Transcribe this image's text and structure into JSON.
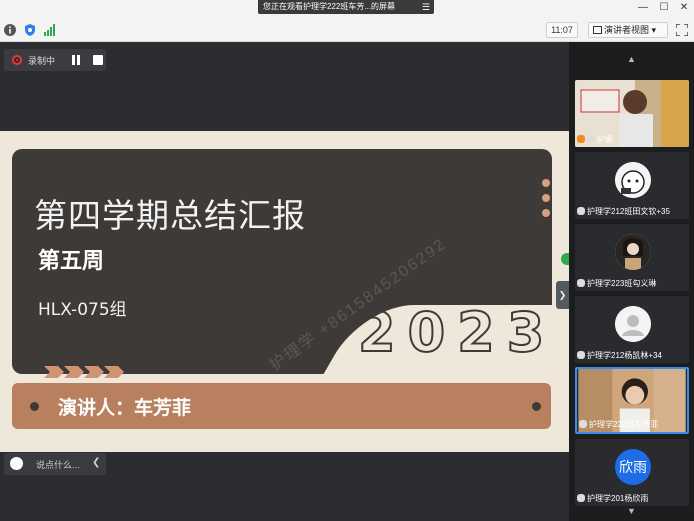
{
  "topbar": {
    "share_banner": "您正在观看护理学222班车芳...的屏幕",
    "clock": "11:07",
    "view_mode": "演讲者视图 ▾",
    "icons": [
      "info-icon",
      "shield-icon",
      "signal-icon"
    ]
  },
  "recording": {
    "label": "录制中"
  },
  "slide": {
    "title": "第四学期总结汇报",
    "week": "第五周",
    "group": "HLX-075组",
    "year": "2023",
    "speaker": "演讲人：车芳菲",
    "watermark": "护理学 +8615845206292"
  },
  "chat": {
    "placeholder": "说点什么..."
  },
  "participants": [
    {
      "name": "护娜",
      "type": "camera"
    },
    {
      "name": "护理学212班田文钦+35",
      "type": "avatar"
    },
    {
      "name": "护理学223班勾义琳",
      "type": "avatar"
    },
    {
      "name": "护理学212杨凯林+34",
      "type": "default-avatar"
    },
    {
      "name": "护理学222班车芳菲",
      "type": "camera",
      "active": true
    },
    {
      "name": "护理学201杨欣雨",
      "type": "text-avatar",
      "avatar_text": "欣雨"
    }
  ],
  "colors": {
    "accent": "#3a8df0",
    "slide_bg": "#efe7da",
    "card": "#3d3a38",
    "brown": "#b8805f"
  }
}
